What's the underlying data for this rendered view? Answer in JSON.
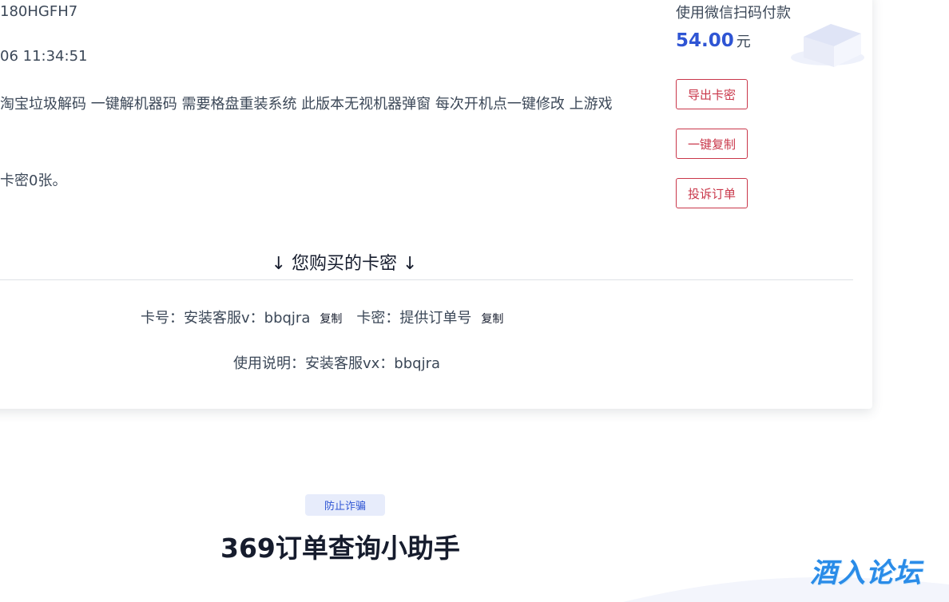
{
  "order": {
    "order_no": "180HGFH7",
    "order_time": "06 11:34:51",
    "goods_desc": "淘宝垃圾解码 一键解机器码 需要格盘重装系统 此版本无视机器弹窗 每次开机点一键修改 上游戏",
    "stock_note": "卡密0张。"
  },
  "payment": {
    "method": "使用微信扫码付款",
    "amount": "54.00",
    "unit": "元"
  },
  "actions": {
    "export": "导出卡密",
    "copy_all": "一键复制",
    "complain": "投诉订单"
  },
  "cards": {
    "heading": "↓ 您购买的卡密 ↓",
    "card_label": "卡号：",
    "card_value": "安装客服v：bbqjra",
    "secret_label": "卡密：",
    "secret_value": "提供订单号",
    "copy_label": "复制",
    "usage_label": "使用说明：",
    "usage_value": "安装客服vx：bbqjra"
  },
  "footer": {
    "badge": "防止诈骗",
    "title": "369订单查询小助手",
    "watermark": "酒入论坛"
  },
  "colors": {
    "primary": "#2f55d4",
    "danger": "#c9374a",
    "heading": "#161c2d",
    "text": "#3c4858"
  }
}
